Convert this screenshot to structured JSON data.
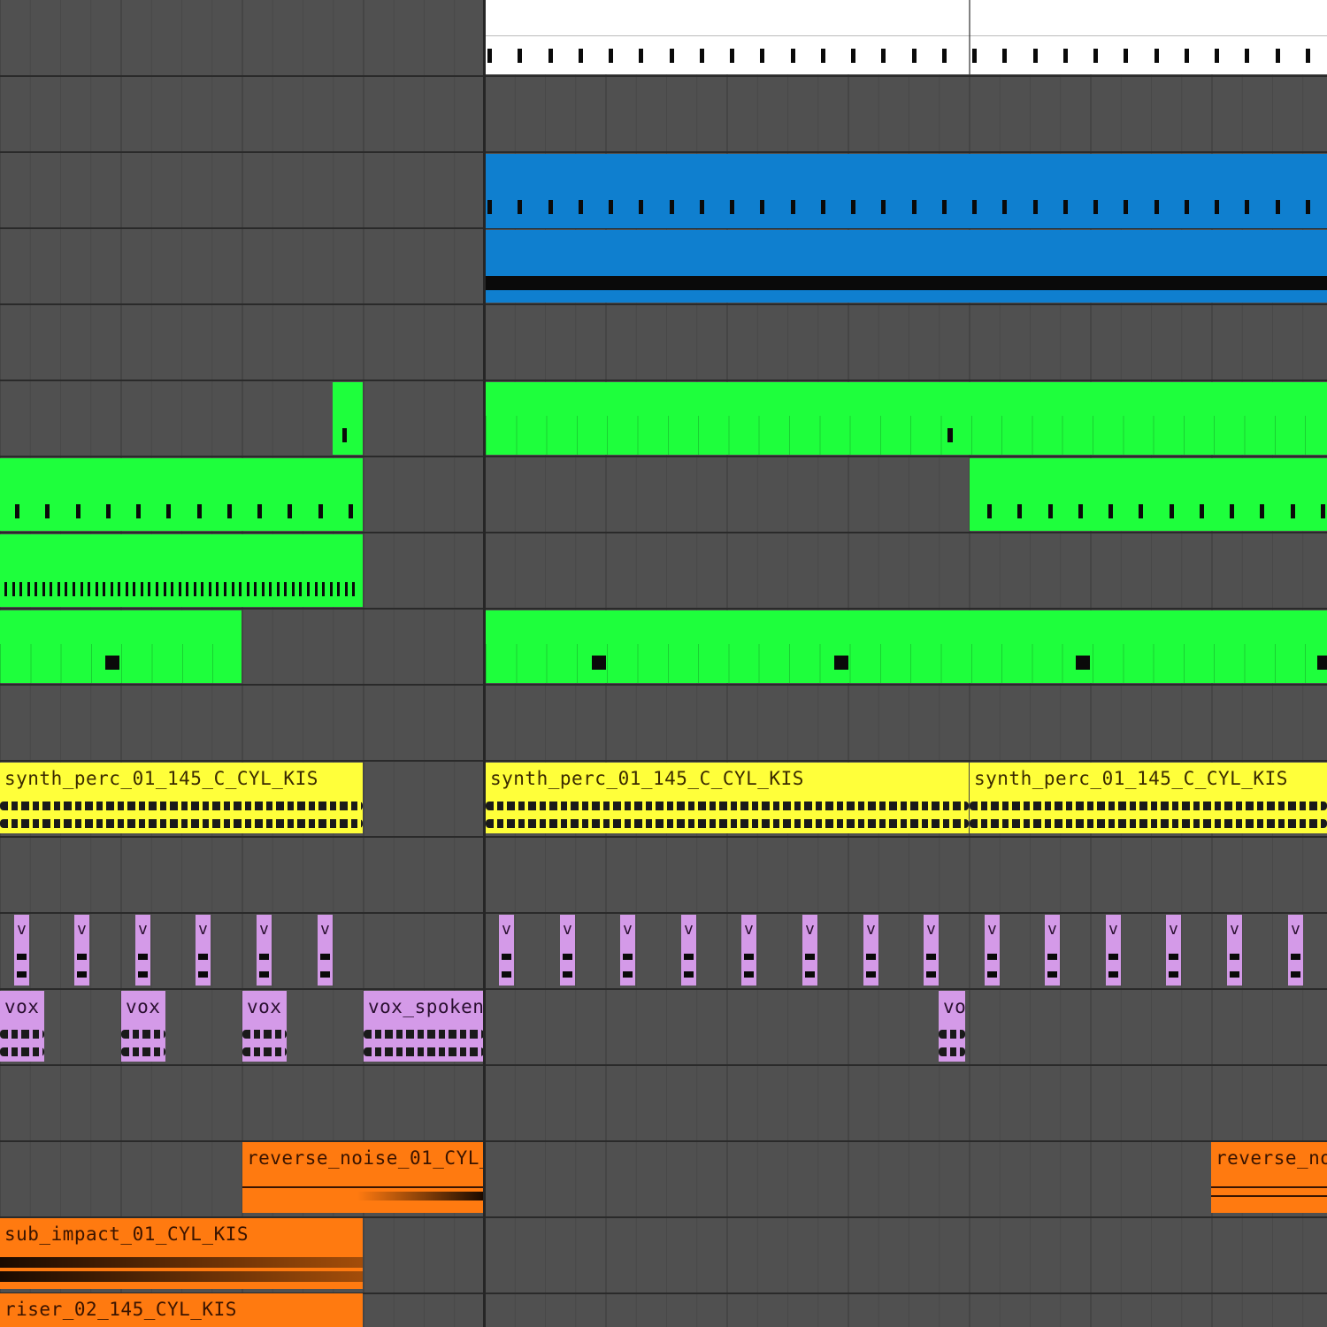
{
  "colors": {
    "background": "#505050",
    "lane_line": "#2a2a2a",
    "midi_white": "#ffffff",
    "midi_blue": "#0f7fcf",
    "midi_green": "#1eff3c",
    "audio_yellow": "#ffff3a",
    "audio_purple": "#d49ae8",
    "audio_orange": "#ff7a10"
  },
  "clips": {
    "synth_perc_1": "synth_perc_01_145_C_CYL_KIS",
    "synth_perc_2": "synth_perc_01_145_C_CYL_KIS",
    "synth_perc_3": "synth_perc_01_145_C_CYL_KIS",
    "vox_1": "vox",
    "vox_2": "vox",
    "vox_3": "vox",
    "vox_spoken": "vox_spoken",
    "vox_small": "vo",
    "vox_short_label": "v",
    "reverse_noise_1": "reverse_noise_01_CYL_",
    "reverse_noise_2": "reverse_no",
    "sub_impact": "sub_impact_01_CYL_KIS",
    "riser": "riser_02_145_CYL_KIS"
  }
}
